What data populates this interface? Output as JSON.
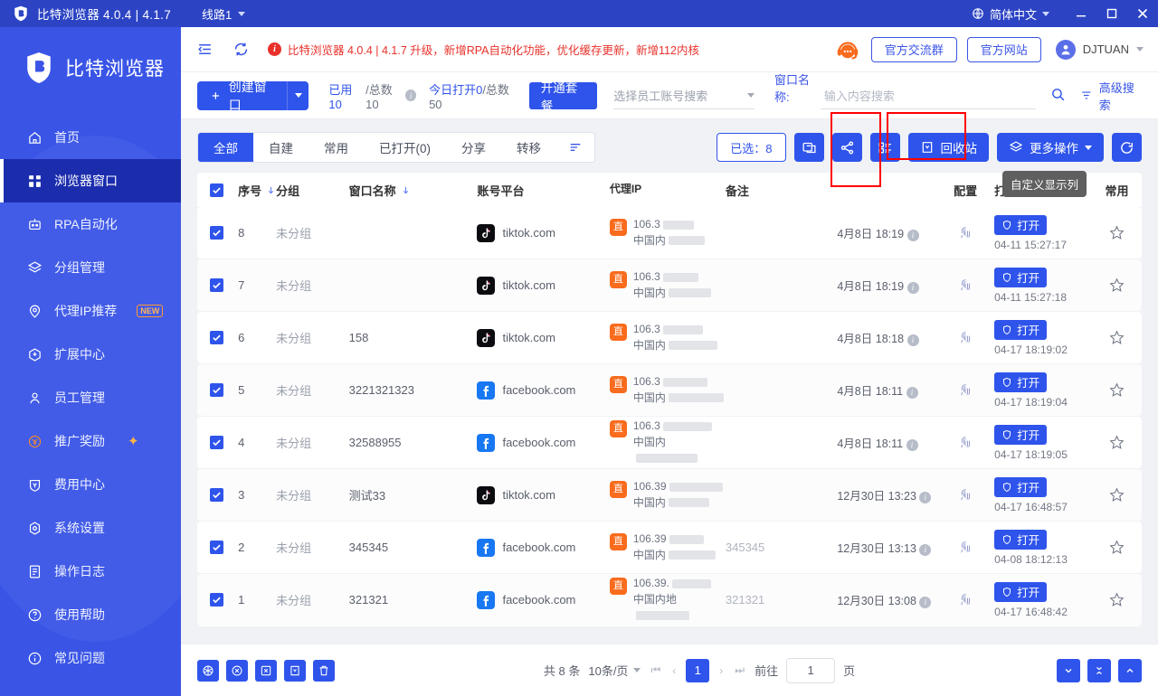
{
  "titlebar": {
    "app_title": "比特浏览器 4.0.4 | 4.1.7",
    "route": "线路1",
    "language": "简体中文",
    "minimize": "—",
    "maximize": "☐",
    "close": "✕"
  },
  "sidebar": {
    "brand": "比特浏览器",
    "items": [
      {
        "label": "首页",
        "icon": "home-icon"
      },
      {
        "label": "浏览器窗口",
        "icon": "grid-icon"
      },
      {
        "label": "RPA自动化",
        "icon": "robot-icon"
      },
      {
        "label": "分组管理",
        "icon": "layers-icon"
      },
      {
        "label": "代理IP推荐",
        "icon": "location-icon",
        "badge": "NEW"
      },
      {
        "label": "扩展中心",
        "icon": "extension-icon"
      },
      {
        "label": "员工管理",
        "icon": "user-icon"
      },
      {
        "label": "推广奖励",
        "icon": "coin-icon",
        "spark": "✦"
      },
      {
        "label": "费用中心",
        "icon": "wallet-icon"
      },
      {
        "label": "系统设置",
        "icon": "settings-icon"
      },
      {
        "label": "操作日志",
        "icon": "log-icon"
      },
      {
        "label": "使用帮助",
        "icon": "help-icon"
      },
      {
        "label": "常见问题",
        "icon": "info-icon"
      }
    ]
  },
  "topbar": {
    "notice_badge": "i",
    "notice": "比特浏览器 4.0.4 | 4.1.7 升级，新增RPA自动化功能，优化缓存更新，新增112内核",
    "official_group": "官方交流群",
    "official_site": "官方网站",
    "user": "DJTUAN"
  },
  "actionbar": {
    "create_window": "创建窗口",
    "used_label": "已用10",
    "total_label": "/总数10",
    "today_open": "今日打开0",
    "today_total": "/总数50",
    "open_package": "开通套餐",
    "staff_select": "选择员工账号搜索",
    "window_name_label": "窗口名称:",
    "window_name_placeholder": "输入内容搜索",
    "advanced_search": "高级搜索"
  },
  "tabs": [
    {
      "label": "全部",
      "active": true
    },
    {
      "label": "自建",
      "active": false
    },
    {
      "label": "常用",
      "active": false
    },
    {
      "label": "已打开(0)",
      "active": false
    },
    {
      "label": "分享",
      "active": false
    },
    {
      "label": "转移",
      "active": false
    }
  ],
  "tools": {
    "selected": "已选：8",
    "copy_icon": "copy-window-icon",
    "share_icon": "share-icon",
    "columns_icon": "custom-columns-icon",
    "recycle_bin": "回收站",
    "more_actions": "更多操作",
    "refresh_icon": "refresh-icon",
    "tooltip": "自定义显示列"
  },
  "table": {
    "headers": [
      "序号",
      "分组",
      "窗口名称",
      "账号平台",
      "代理IP",
      "备注",
      "",
      "配置",
      "打开",
      "常用"
    ],
    "rows": [
      {
        "checked": true,
        "idx": "8",
        "group": "未分组",
        "name": "",
        "platform": "tiktok.com",
        "platform_icon": "tiktok-icon",
        "ip_badge": "直",
        "ip_line1": "106.3",
        "ip_line2": "中国内",
        "note": "",
        "time": "4月8日 18:19",
        "open_label": "打开",
        "open_time": "04-11 15:27:17"
      },
      {
        "checked": true,
        "idx": "7",
        "group": "未分组",
        "name": "",
        "platform": "tiktok.com",
        "platform_icon": "tiktok-icon",
        "ip_badge": "直",
        "ip_line1": "106.3",
        "ip_line2": "中国内",
        "note": "",
        "time": "4月8日 18:19",
        "open_label": "打开",
        "open_time": "04-11 15:27:18"
      },
      {
        "checked": true,
        "idx": "6",
        "group": "未分组",
        "name": "158",
        "platform": "tiktok.com",
        "platform_icon": "tiktok-icon",
        "ip_badge": "直",
        "ip_line1": "106.3",
        "ip_line2": "中国内",
        "note": "",
        "time": "4月8日 18:18",
        "open_label": "打开",
        "open_time": "04-17 18:19:02"
      },
      {
        "checked": true,
        "idx": "5",
        "group": "未分组",
        "name": "3221321323",
        "platform": "facebook.com",
        "platform_icon": "facebook-icon",
        "ip_badge": "直",
        "ip_line1": "106.3",
        "ip_line2": "中国内",
        "note": "",
        "time": "4月8日 18:11",
        "open_label": "打开",
        "open_time": "04-17 18:19:04"
      },
      {
        "checked": true,
        "idx": "4",
        "group": "未分组",
        "name": "32588955",
        "platform": "facebook.com",
        "platform_icon": "facebook-icon",
        "ip_badge": "直",
        "ip_line1": "106.3",
        "ip_line2": "中国内",
        "note": "",
        "time": "4月8日 18:11",
        "open_label": "打开",
        "open_time": "04-17 18:19:05"
      },
      {
        "checked": true,
        "idx": "3",
        "group": "未分组",
        "name": "测试33",
        "platform": "tiktok.com",
        "platform_icon": "tiktok-icon",
        "ip_badge": "直",
        "ip_line1": "106.39",
        "ip_line2": "中国内",
        "note": "",
        "time": "12月30日 13:23",
        "open_label": "打开",
        "open_time": "04-17 16:48:57"
      },
      {
        "checked": true,
        "idx": "2",
        "group": "未分组",
        "name": "345345",
        "platform": "facebook.com",
        "platform_icon": "facebook-icon",
        "ip_badge": "直",
        "ip_line1": "106.39",
        "ip_line2": "中国内",
        "note": "345345",
        "time": "12月30日 13:13",
        "open_label": "打开",
        "open_time": "04-08 18:12:13"
      },
      {
        "checked": true,
        "idx": "1",
        "group": "未分组",
        "name": "321321",
        "platform": "facebook.com",
        "platform_icon": "facebook-icon",
        "ip_badge": "直",
        "ip_line1": "106.39.",
        "ip_line2": "中国内地",
        "note": "321321",
        "time": "12月30日 13:08",
        "open_label": "打开",
        "open_time": "04-17 16:48:42"
      }
    ]
  },
  "footer": {
    "total": "共 8 条",
    "page_size": "10条/页",
    "current_page": "1",
    "goto_label": "前往",
    "goto_value": "1",
    "page_unit": "页"
  },
  "colors": {
    "primary": "#2f54eb",
    "sidebar": "#3a55e6",
    "titlebar": "#2c44c4",
    "active_nav": "#1b2dad",
    "notice_red": "#e8312b",
    "annotation_red": "#ff0000",
    "orange": "#f96b1d"
  }
}
